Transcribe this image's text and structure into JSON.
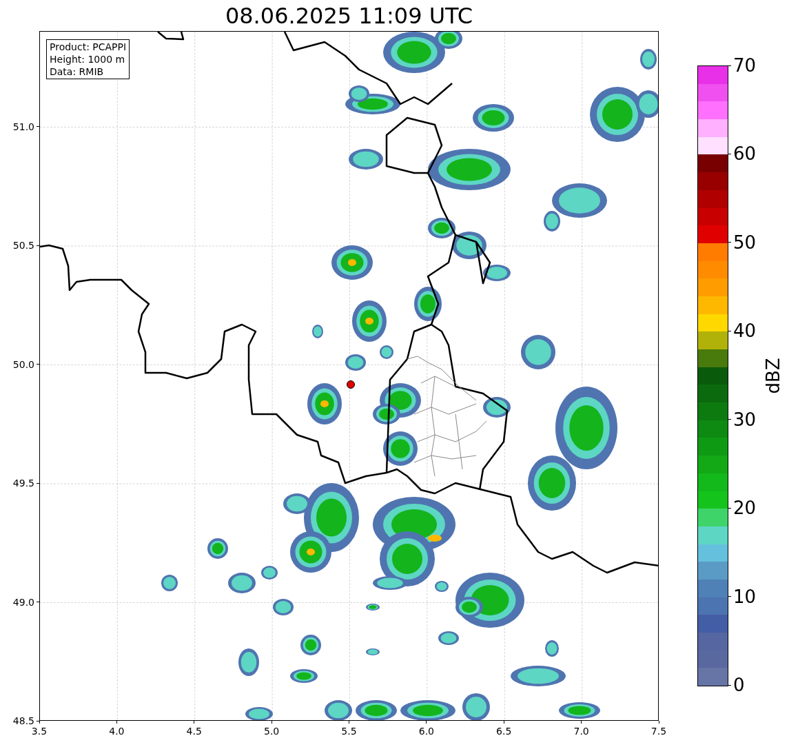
{
  "title": "08.06.2025 11:09 UTC",
  "info_box": [
    "Product: PCAPPI",
    "Height: 1000 m",
    "Data: RMIB"
  ],
  "x_ticks": [
    "3.5",
    "4.0",
    "4.5",
    "5.0",
    "5.5",
    "6.0",
    "6.5",
    "7.0",
    "7.5"
  ],
  "y_ticks": [
    "51.0",
    "50.5",
    "50.0",
    "49.5",
    "49.0",
    "48.5"
  ],
  "colorbar": {
    "label": "dBZ",
    "ticks": [
      "70",
      "60",
      "50",
      "40",
      "30",
      "20",
      "10",
      "0"
    ],
    "bands": [
      {
        "color": "#e830e8"
      },
      {
        "color": "#f050f0"
      },
      {
        "color": "#ff70ff"
      },
      {
        "color": "#ffb0ff"
      },
      {
        "color": "#ffe0ff"
      },
      {
        "color": "#780000"
      },
      {
        "color": "#980000"
      },
      {
        "color": "#b00000"
      },
      {
        "color": "#c80000"
      },
      {
        "color": "#e00000"
      },
      {
        "color": "#ff7c00"
      },
      {
        "color": "#ff8c00"
      },
      {
        "color": "#ff9c00"
      },
      {
        "color": "#ffb800"
      },
      {
        "color": "#ffd800"
      },
      {
        "color": "#b0b20a"
      },
      {
        "color": "#487a0c"
      },
      {
        "color": "#0a5a0c"
      },
      {
        "color": "#0b6a0e"
      },
      {
        "color": "#0d7a10"
      },
      {
        "color": "#0e8a12"
      },
      {
        "color": "#0f9a14"
      },
      {
        "color": "#12a816"
      },
      {
        "color": "#13b81a"
      },
      {
        "color": "#14c41c"
      },
      {
        "color": "#3ed46a"
      },
      {
        "color": "#5dd6c4"
      },
      {
        "color": "#64c0dc"
      },
      {
        "color": "#5a9bc6"
      },
      {
        "color": "#4f80b6"
      },
      {
        "color": "#4b74b0"
      },
      {
        "color": "#445ea6"
      },
      {
        "color": "#5566a0"
      },
      {
        "color": "#5a68a0"
      },
      {
        "color": "#6674a6"
      }
    ]
  }
}
